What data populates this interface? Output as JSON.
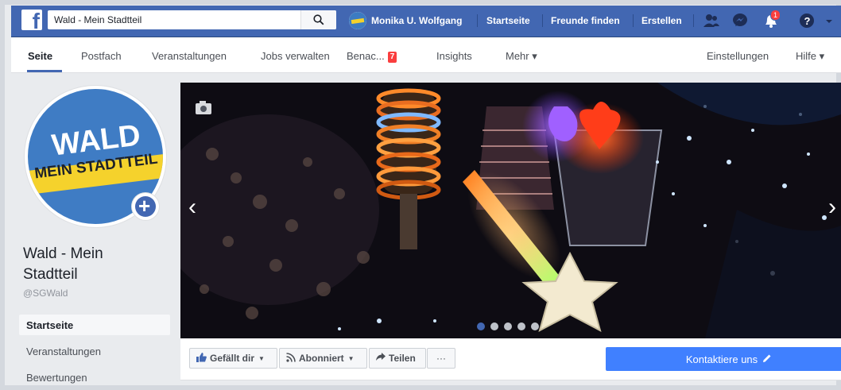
{
  "topbar": {
    "search_value": "Wald - Mein Stadtteil",
    "user_name": "Monika U. Wolfgang",
    "links": [
      "Startseite",
      "Freunde finden",
      "Erstellen"
    ],
    "notification_count": "1"
  },
  "tabs": {
    "items": [
      "Seite",
      "Postfach",
      "Veranstaltungen",
      "Jobs verwalten",
      "Benac...",
      "Insights",
      "Mehr ▾"
    ],
    "badge": "7",
    "right": [
      "Einstellungen",
      "Hilfe ▾"
    ]
  },
  "profile": {
    "pic_line1": "WALD",
    "pic_line2": "MEIN STADTTEIL",
    "name": "Wald - Mein Stadtteil",
    "handle": "@SGWald"
  },
  "leftnav": [
    "Startseite",
    "Veranstaltungen",
    "Bewertungen"
  ],
  "actions": {
    "like": "Gefällt dir",
    "follow": "Abonniert",
    "share": "Teilen",
    "more": "···",
    "contact": "Kontaktiere uns"
  },
  "colors": {
    "brand": "#4267b2",
    "contact": "#4080ff",
    "badge": "#fa3e3e",
    "logo_yellow": "#f5d22c"
  },
  "icons": [
    "facebook-logo",
    "search-icon",
    "friends-icon",
    "messenger-icon",
    "bell-icon",
    "help-icon",
    "camera-icon",
    "thumbs-up-icon",
    "rss-icon",
    "share-arrow-icon",
    "pencil-icon"
  ]
}
